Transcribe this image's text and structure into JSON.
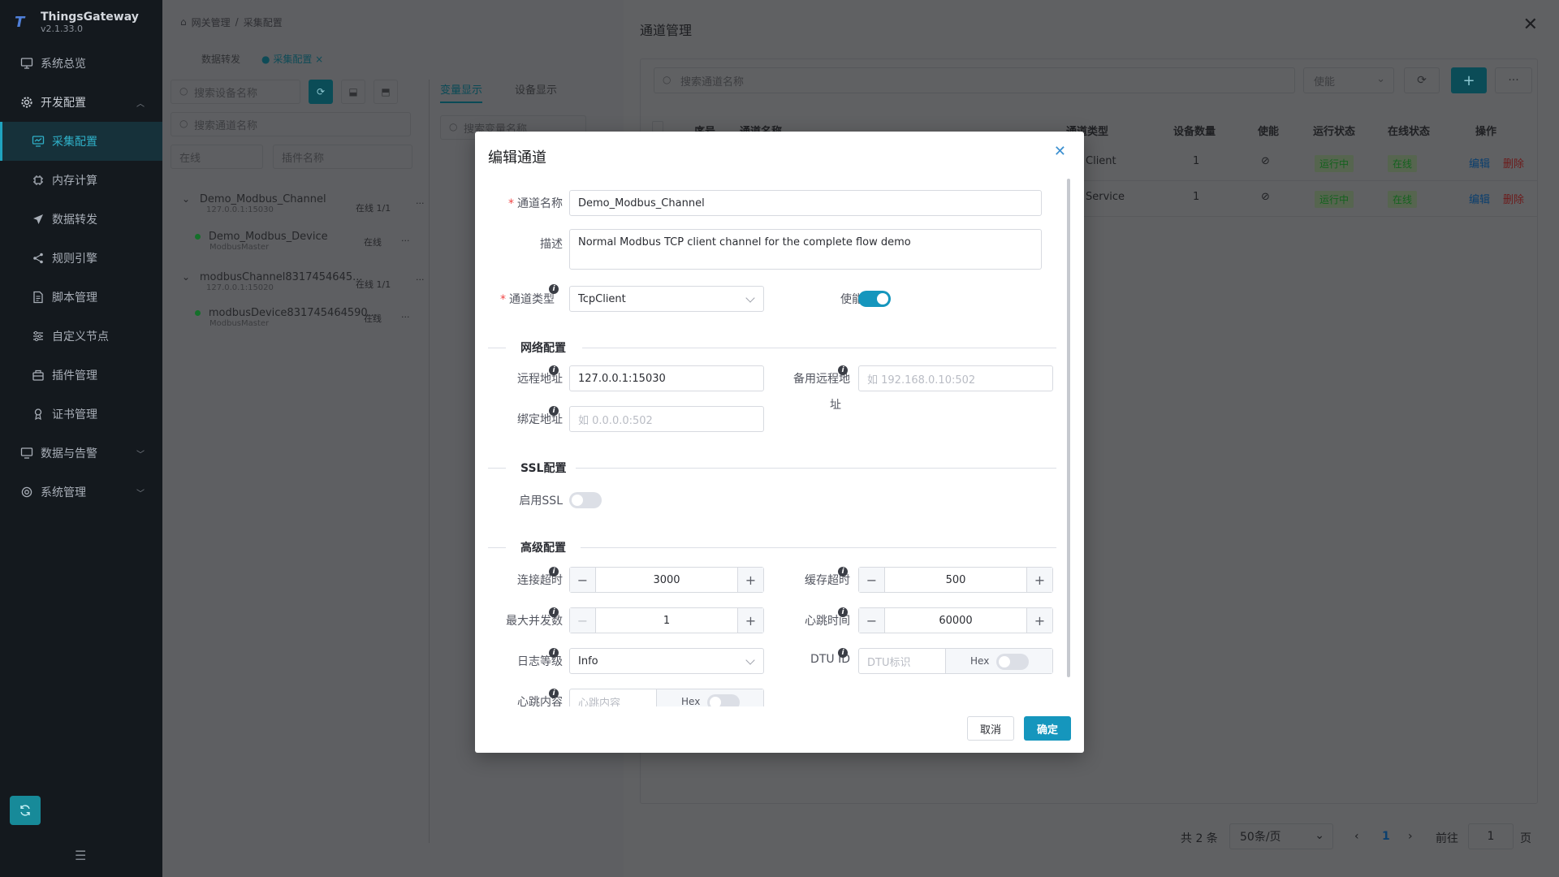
{
  "sidebar": {
    "brand_name": "ThingsGateway",
    "version": "v2.1.33.0",
    "items": [
      {
        "label": "系统总览"
      },
      {
        "label": "开发配置"
      },
      {
        "label": "采集配置"
      },
      {
        "label": "内存计算"
      },
      {
        "label": "数据转发"
      },
      {
        "label": "规则引擎"
      },
      {
        "label": "脚本管理"
      },
      {
        "label": "自定义节点"
      },
      {
        "label": "插件管理"
      },
      {
        "label": "证书管理"
      },
      {
        "label": "数据与告警"
      },
      {
        "label": "系统管理"
      }
    ]
  },
  "main": {
    "breadcrumb_root": "网关管理",
    "breadcrumb_sep": "/",
    "breadcrumb_current": "采集配置",
    "tabs": [
      {
        "label": "数据转发"
      },
      {
        "label": "采集配置"
      }
    ],
    "device_search_placeholder": "搜索设备名称",
    "channel_search_placeholder": "搜索通道名称",
    "status_select": "在线",
    "plugin_select_placeholder": "插件名称",
    "tree": [
      {
        "title": "Demo_Modbus_Channel",
        "sub": "127.0.0.1:15030",
        "state": "在线 1/1"
      },
      {
        "title": "Demo_Modbus_Device",
        "sub": "ModbusMaster",
        "state": "在线"
      },
      {
        "title": "modbusChannel8317454645...",
        "sub": "127.0.0.1:15020",
        "state": "在线 1/1"
      },
      {
        "title": "modbusDevice831745464590...",
        "sub": "ModbusMaster",
        "state": "在线"
      }
    ],
    "right_tabs": [
      {
        "label": "变量显示"
      },
      {
        "label": "设备显示"
      }
    ],
    "variable_search_placeholder": "搜索变量名称"
  },
  "drawer": {
    "title": "通道管理",
    "search_placeholder": "搜索通道名称",
    "enable_select_placeholder": "使能",
    "columns": [
      "序号",
      "通道名称",
      "通道类型",
      "设备数量",
      "使能",
      "运行状态",
      "在线状态",
      "操作"
    ],
    "rows": [
      {
        "type": "Client",
        "count": "1",
        "run": "运行中",
        "online": "在线",
        "edit": "编辑",
        "delete": "删除"
      },
      {
        "type": "Service",
        "count": "1",
        "run": "运行中",
        "online": "在线",
        "edit": "编辑",
        "delete": "删除"
      }
    ],
    "pager": {
      "total": "共 2 条",
      "page_size": "50条/页",
      "current_page": "1",
      "goto_label": "前往",
      "goto_value": "1",
      "page_unit": "页"
    }
  },
  "dialog": {
    "title": "编辑通道",
    "channel_name_label": "通道名称",
    "channel_name_value": "Demo_Modbus_Channel",
    "desc_label": "描述",
    "desc_value": "Normal Modbus TCP client channel for the complete flow demo",
    "channel_type_label": "通道类型",
    "channel_type_value": "TcpClient",
    "enable_label": "使能",
    "enable_on": true,
    "network_section": "网络配置",
    "remote_addr_label": "远程地址",
    "remote_addr_value": "127.0.0.1:15030",
    "backup_remote_label_1": "备用远程地",
    "backup_remote_label_2": "址",
    "backup_remote_placeholder": "如 192.168.0.10:502",
    "bind_addr_label": "绑定地址",
    "bind_addr_placeholder": "如 0.0.0.0:502",
    "ssl_section": "SSL配置",
    "ssl_enable_label": "启用SSL",
    "ssl_on": false,
    "advanced_section": "高级配置",
    "connect_timeout_label": "连接超时",
    "connect_timeout_value": "3000",
    "cache_timeout_label": "缓存超时",
    "cache_timeout_value": "500",
    "max_concurrency_label": "最大并发数",
    "max_concurrency_value": "1",
    "heartbeat_time_label": "心跳时间",
    "heartbeat_time_value": "60000",
    "log_level_label": "日志等级",
    "log_level_value": "Info",
    "dtu_id_label": "DTU ID",
    "dtu_id_placeholder": "DTU标识",
    "hex_label": "Hex",
    "heartbeat_content_label": "心跳内容",
    "heartbeat_content_placeholder": "心跳内容",
    "cancel_label": "取消",
    "ok_label": "确定"
  },
  "colors": {
    "accent": "#1596bd",
    "sidebar_bg": "#14191e",
    "required": "#f04646"
  }
}
